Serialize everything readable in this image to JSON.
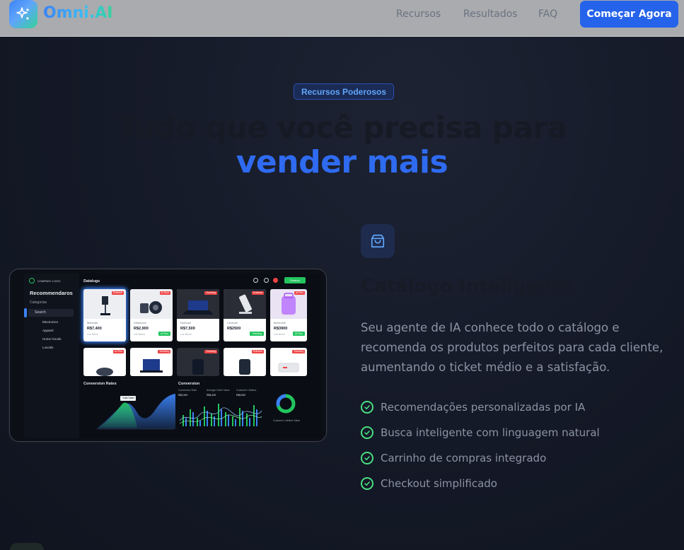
{
  "nav": {
    "brand": "Omni.AI",
    "links": [
      "Recursos",
      "Resultados",
      "FAQ"
    ],
    "cta": "Começar Agora"
  },
  "hero": {
    "badge": "Recursos Poderosos",
    "title_line1": "Tudo que você precisa para",
    "title_line2": "vender mais"
  },
  "feature": {
    "icon": "shopping-bag-icon",
    "title": "Catálogo Inteligente",
    "description": "Seu agente de IA conhece todo o catálogo e recomenda os produtos perfeitos para cada cliente, aumentando o ticket médio e a satisfação.",
    "items": [
      "Recomendações personalizadas por IA",
      "Busca inteligente com linguagem natural",
      "Carrinho de compras integrado",
      "Checkout simplificado"
    ]
  },
  "dashboard": {
    "company": "COMPANY LOGO",
    "sidebar_title": "Recommendaros",
    "sidebar_items": [
      "Categorias",
      "Search"
    ],
    "sidebar_sub": [
      "Electronics",
      "Apparel",
      "Home Goods",
      "Loucals"
    ],
    "top_label": "Datalugs",
    "top_button": "Estatus",
    "products": [
      {
        "name": "Melende",
        "price": "R$7,400",
        "sub": "Lue Berch",
        "tag": "Extreme"
      },
      {
        "name": "Dielecnes",
        "price": "R$2,900",
        "sub": "Lue Berch",
        "tag": "AI Stud",
        "button": "Ai Plus"
      },
      {
        "name": "Notnope",
        "price": "R$7,500",
        "sub": "Lue Berch",
        "tag": "Trending"
      },
      {
        "name": "Centrole",
        "price": "R$2500",
        "sub": "",
        "tag": "Extreme",
        "button": "Trending"
      },
      {
        "name": "Blorirnele",
        "price": "R$3900",
        "sub": "Lue Berch",
        "tag": "AI Plus",
        "button": "AI Plus"
      }
    ],
    "row2_tags": [
      "AI Plus",
      "Trending",
      "Trending",
      "Extreme",
      "Trending"
    ],
    "panel1_title": "Conversion Rates",
    "panel1_tooltip": "Total Sales",
    "panel2_title": "Conversion",
    "panel2_legend": [
      "Conversion Rate",
      "Average Order Value",
      "Customer Lifetime"
    ],
    "panel2_values": [
      "R$2,900",
      "R$5,400",
      "R$6,500"
    ],
    "donut_label": "Customer Lifetime Value"
  },
  "colors": {
    "accent": "#2f6bf1",
    "cta": "#2563eb",
    "check": "#4ade80"
  }
}
